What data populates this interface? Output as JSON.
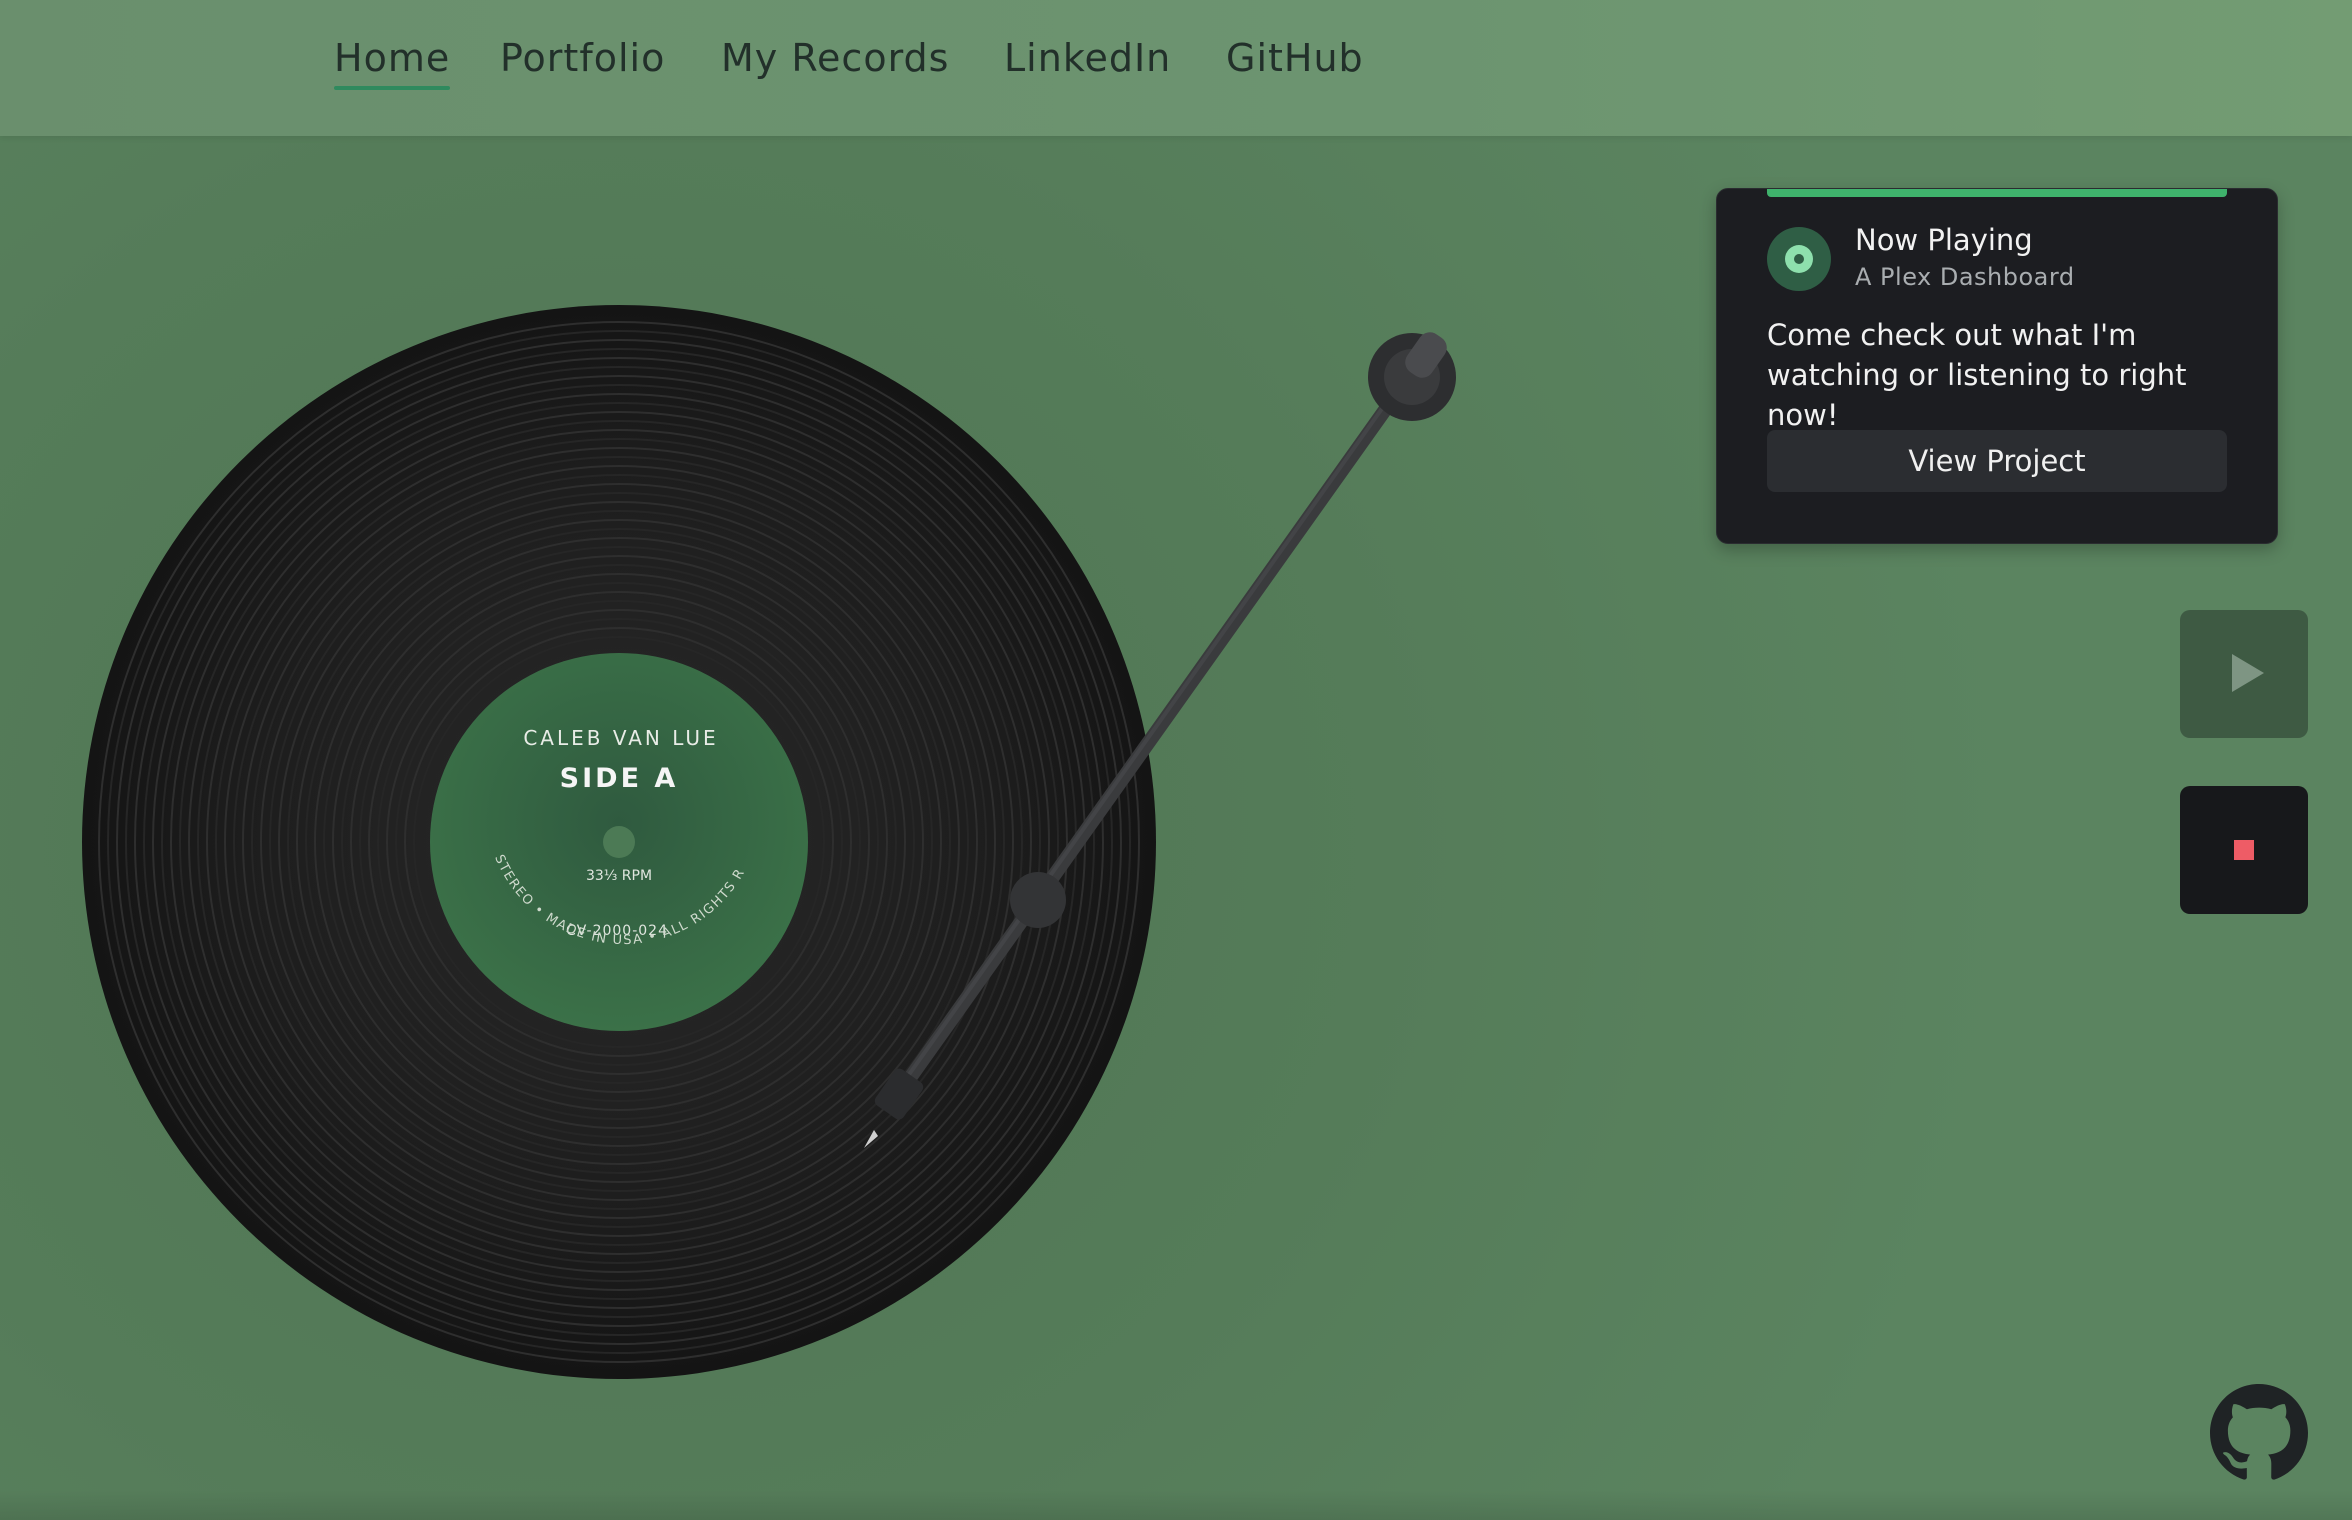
{
  "nav": {
    "items": [
      {
        "label": "Home",
        "active": true
      },
      {
        "label": "Portfolio",
        "active": false
      },
      {
        "label": "My Records",
        "active": false
      },
      {
        "label": "LinkedIn",
        "active": false
      },
      {
        "label": "GitHub",
        "active": false
      }
    ]
  },
  "record": {
    "artist": "CALEB VAN LUE",
    "side": "SIDE A",
    "speed": "33⅓ RPM",
    "catalog": "CV-2000-024",
    "rim_text": "STEREO • MADE IN USA • ALL RIGHTS RESERVED"
  },
  "now_playing": {
    "heading": "Now Playing",
    "subtitle": "A Plex Dashboard",
    "description": "Come check out what I'm watching or listening to right now!",
    "button_label": "View Project",
    "progress_fraction": 1.0,
    "icon": "vinyl-icon"
  },
  "controls": {
    "play_icon": "play-icon",
    "stop_icon": "stop-icon"
  },
  "footer": {
    "github_icon": "github-icon"
  },
  "colors": {
    "accent": "#3fb26c",
    "background": "#557c59",
    "nav_bg": "#6c9470",
    "card_bg": "#1c1d21",
    "stop_red": "#ee5c66"
  }
}
